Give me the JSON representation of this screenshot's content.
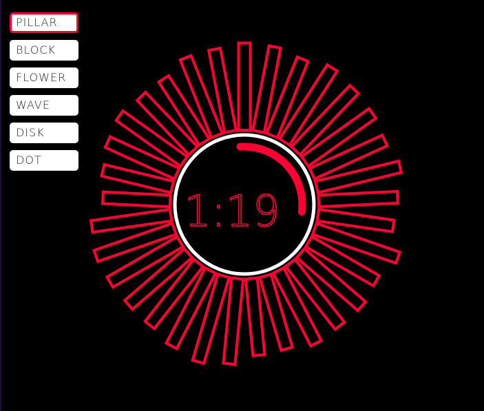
{
  "menu": {
    "items": [
      {
        "label": "PILLAR",
        "active": true
      },
      {
        "label": "BLOCK",
        "active": false
      },
      {
        "label": "FLOWER",
        "active": false
      },
      {
        "label": "WAVE",
        "active": false
      },
      {
        "label": "DISK",
        "active": false
      },
      {
        "label": "DOT",
        "active": false
      }
    ]
  },
  "player": {
    "time": "1:19",
    "progress": 0.27
  },
  "visualizer": {
    "mode": "pillar",
    "accent_color": "#ff0033",
    "ring_color": "#ffffff",
    "bar_levels": [
      0.95,
      0.93,
      0.85,
      0.97,
      0.9,
      0.86,
      0.8,
      0.92,
      0.78,
      0.72,
      0.97,
      0.76,
      0.82,
      0.8,
      0.84,
      0.72,
      0.74,
      0.92,
      1.0,
      0.9,
      0.78,
      0.78,
      0.82,
      0.86,
      0.8,
      0.54,
      0.62,
      0.72,
      0.78,
      0.7,
      0.7,
      0.88,
      0.88
    ]
  }
}
